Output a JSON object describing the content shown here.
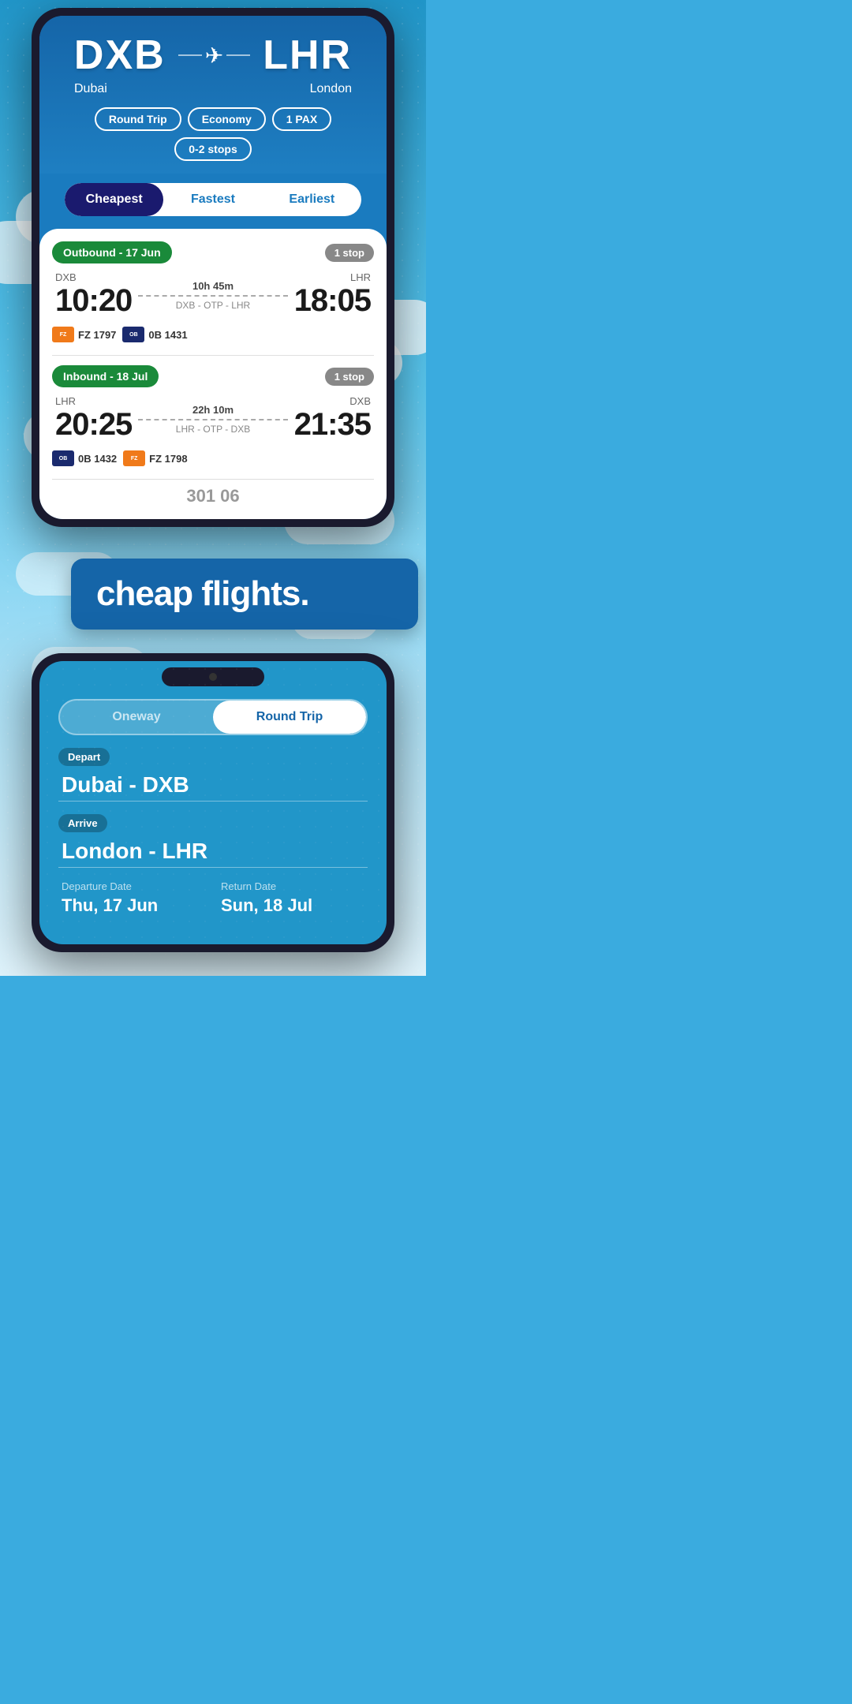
{
  "phone1": {
    "route": {
      "from_code": "DXB",
      "from_city": "Dubai",
      "to_code": "LHR",
      "to_city": "London"
    },
    "filters": {
      "trip_type": "Round Trip",
      "cabin": "Economy",
      "pax": "1 PAX",
      "stops": "0-2 stops"
    },
    "tabs": [
      {
        "label": "Cheapest",
        "active": true
      },
      {
        "label": "Fastest",
        "active": false
      },
      {
        "label": "Earliest",
        "active": false
      }
    ],
    "outbound": {
      "header": "Outbound - 17 Jun",
      "stops_badge": "1 stop",
      "from": "DXB",
      "to": "LHR",
      "depart": "10:20",
      "arrive": "18:05",
      "duration": "10h 45m",
      "via": "DXB - OTP - LHR",
      "airlines": [
        {
          "color": "orange",
          "logo": "FZ",
          "flight": "FZ 1797"
        },
        {
          "color": "navy",
          "logo": "OB",
          "flight": "0B 1431"
        }
      ]
    },
    "inbound": {
      "header": "Inbound - 18 Jul",
      "stops_badge": "1 stop",
      "from": "LHR",
      "to": "DXB",
      "depart": "20:25",
      "arrive": "21:35",
      "duration": "22h 10m",
      "via": "LHR - OTP - DXB",
      "airlines": [
        {
          "color": "navy",
          "logo": "OB",
          "flight": "0B 1432"
        },
        {
          "color": "orange",
          "logo": "FZ",
          "flight": "FZ 1798"
        }
      ]
    },
    "price_peek": "301 06"
  },
  "promo": {
    "text": "cheap flights."
  },
  "phone2": {
    "trip_options": [
      {
        "label": "Oneway",
        "active": false
      },
      {
        "label": "Round Trip",
        "active": true
      }
    ],
    "depart_label": "Depart",
    "depart_value": "Dubai - DXB",
    "arrive_label": "Arrive",
    "arrive_value": "London - LHR",
    "departure_date_label": "Departure Date",
    "departure_date_value": "Thu, 17 Jun",
    "return_date_label": "Return Date",
    "return_date_value": "Sun, 18 Jul"
  }
}
